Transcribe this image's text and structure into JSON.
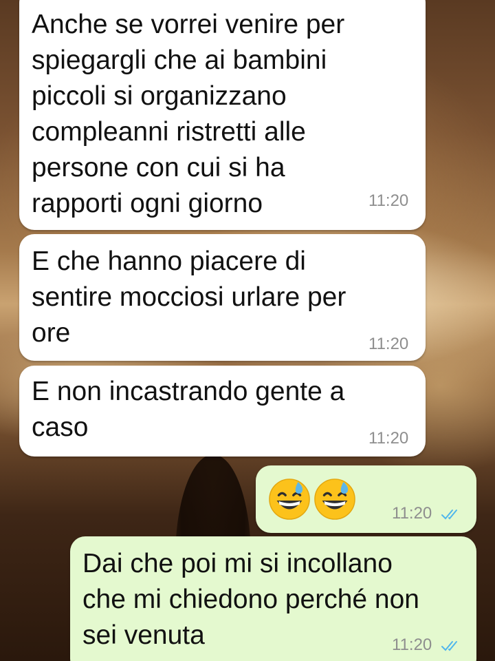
{
  "messages": [
    {
      "direction": "incoming",
      "text": "Anche se vorrei venire per\nspiegargli che ai bambini\npiccoli si organizzano\ncompleanni ristretti alle\npersone con cui si ha\nrapporti ogni giorno",
      "time": "11:20"
    },
    {
      "direction": "incoming",
      "text": "E che hanno piacere di\nsentire mocciosi urlare per\nore",
      "time": "11:20"
    },
    {
      "direction": "incoming",
      "text": "E non incastrando gente a\ncaso",
      "time": "11:20"
    },
    {
      "direction": "outgoing",
      "emojis": [
        "grinning-face-with-sweat",
        "grinning-face-with-sweat"
      ],
      "time": "11:20",
      "status": "read"
    },
    {
      "direction": "outgoing",
      "text": "Dai che poi mi si incollano\nche mi chiedono perché non\nsei venuta",
      "time": "11:20",
      "status": "read"
    }
  ],
  "colors": {
    "incoming_bubble": "#ffffff",
    "outgoing_bubble": "#e4f9cf",
    "read_ticks": "#4fb6ec",
    "timestamp": "#8e8e8e"
  }
}
